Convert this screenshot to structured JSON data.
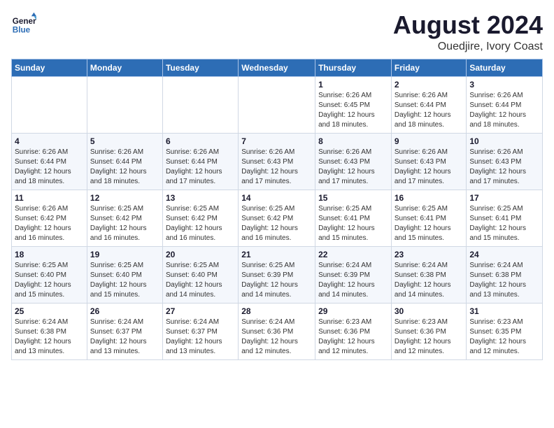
{
  "logo": {
    "line1": "General",
    "line2": "Blue"
  },
  "header": {
    "month": "August 2024",
    "location": "Ouedjire, Ivory Coast"
  },
  "weekdays": [
    "Sunday",
    "Monday",
    "Tuesday",
    "Wednesday",
    "Thursday",
    "Friday",
    "Saturday"
  ],
  "weeks": [
    [
      {
        "day": "",
        "info": ""
      },
      {
        "day": "",
        "info": ""
      },
      {
        "day": "",
        "info": ""
      },
      {
        "day": "",
        "info": ""
      },
      {
        "day": "1",
        "info": "Sunrise: 6:26 AM\nSunset: 6:45 PM\nDaylight: 12 hours\nand 18 minutes."
      },
      {
        "day": "2",
        "info": "Sunrise: 6:26 AM\nSunset: 6:44 PM\nDaylight: 12 hours\nand 18 minutes."
      },
      {
        "day": "3",
        "info": "Sunrise: 6:26 AM\nSunset: 6:44 PM\nDaylight: 12 hours\nand 18 minutes."
      }
    ],
    [
      {
        "day": "4",
        "info": "Sunrise: 6:26 AM\nSunset: 6:44 PM\nDaylight: 12 hours\nand 18 minutes."
      },
      {
        "day": "5",
        "info": "Sunrise: 6:26 AM\nSunset: 6:44 PM\nDaylight: 12 hours\nand 18 minutes."
      },
      {
        "day": "6",
        "info": "Sunrise: 6:26 AM\nSunset: 6:44 PM\nDaylight: 12 hours\nand 17 minutes."
      },
      {
        "day": "7",
        "info": "Sunrise: 6:26 AM\nSunset: 6:43 PM\nDaylight: 12 hours\nand 17 minutes."
      },
      {
        "day": "8",
        "info": "Sunrise: 6:26 AM\nSunset: 6:43 PM\nDaylight: 12 hours\nand 17 minutes."
      },
      {
        "day": "9",
        "info": "Sunrise: 6:26 AM\nSunset: 6:43 PM\nDaylight: 12 hours\nand 17 minutes."
      },
      {
        "day": "10",
        "info": "Sunrise: 6:26 AM\nSunset: 6:43 PM\nDaylight: 12 hours\nand 17 minutes."
      }
    ],
    [
      {
        "day": "11",
        "info": "Sunrise: 6:26 AM\nSunset: 6:42 PM\nDaylight: 12 hours\nand 16 minutes."
      },
      {
        "day": "12",
        "info": "Sunrise: 6:25 AM\nSunset: 6:42 PM\nDaylight: 12 hours\nand 16 minutes."
      },
      {
        "day": "13",
        "info": "Sunrise: 6:25 AM\nSunset: 6:42 PM\nDaylight: 12 hours\nand 16 minutes."
      },
      {
        "day": "14",
        "info": "Sunrise: 6:25 AM\nSunset: 6:42 PM\nDaylight: 12 hours\nand 16 minutes."
      },
      {
        "day": "15",
        "info": "Sunrise: 6:25 AM\nSunset: 6:41 PM\nDaylight: 12 hours\nand 15 minutes."
      },
      {
        "day": "16",
        "info": "Sunrise: 6:25 AM\nSunset: 6:41 PM\nDaylight: 12 hours\nand 15 minutes."
      },
      {
        "day": "17",
        "info": "Sunrise: 6:25 AM\nSunset: 6:41 PM\nDaylight: 12 hours\nand 15 minutes."
      }
    ],
    [
      {
        "day": "18",
        "info": "Sunrise: 6:25 AM\nSunset: 6:40 PM\nDaylight: 12 hours\nand 15 minutes."
      },
      {
        "day": "19",
        "info": "Sunrise: 6:25 AM\nSunset: 6:40 PM\nDaylight: 12 hours\nand 15 minutes."
      },
      {
        "day": "20",
        "info": "Sunrise: 6:25 AM\nSunset: 6:40 PM\nDaylight: 12 hours\nand 14 minutes."
      },
      {
        "day": "21",
        "info": "Sunrise: 6:25 AM\nSunset: 6:39 PM\nDaylight: 12 hours\nand 14 minutes."
      },
      {
        "day": "22",
        "info": "Sunrise: 6:24 AM\nSunset: 6:39 PM\nDaylight: 12 hours\nand 14 minutes."
      },
      {
        "day": "23",
        "info": "Sunrise: 6:24 AM\nSunset: 6:38 PM\nDaylight: 12 hours\nand 14 minutes."
      },
      {
        "day": "24",
        "info": "Sunrise: 6:24 AM\nSunset: 6:38 PM\nDaylight: 12 hours\nand 13 minutes."
      }
    ],
    [
      {
        "day": "25",
        "info": "Sunrise: 6:24 AM\nSunset: 6:38 PM\nDaylight: 12 hours\nand 13 minutes."
      },
      {
        "day": "26",
        "info": "Sunrise: 6:24 AM\nSunset: 6:37 PM\nDaylight: 12 hours\nand 13 minutes."
      },
      {
        "day": "27",
        "info": "Sunrise: 6:24 AM\nSunset: 6:37 PM\nDaylight: 12 hours\nand 13 minutes."
      },
      {
        "day": "28",
        "info": "Sunrise: 6:24 AM\nSunset: 6:36 PM\nDaylight: 12 hours\nand 12 minutes."
      },
      {
        "day": "29",
        "info": "Sunrise: 6:23 AM\nSunset: 6:36 PM\nDaylight: 12 hours\nand 12 minutes."
      },
      {
        "day": "30",
        "info": "Sunrise: 6:23 AM\nSunset: 6:36 PM\nDaylight: 12 hours\nand 12 minutes."
      },
      {
        "day": "31",
        "info": "Sunrise: 6:23 AM\nSunset: 6:35 PM\nDaylight: 12 hours\nand 12 minutes."
      }
    ]
  ]
}
